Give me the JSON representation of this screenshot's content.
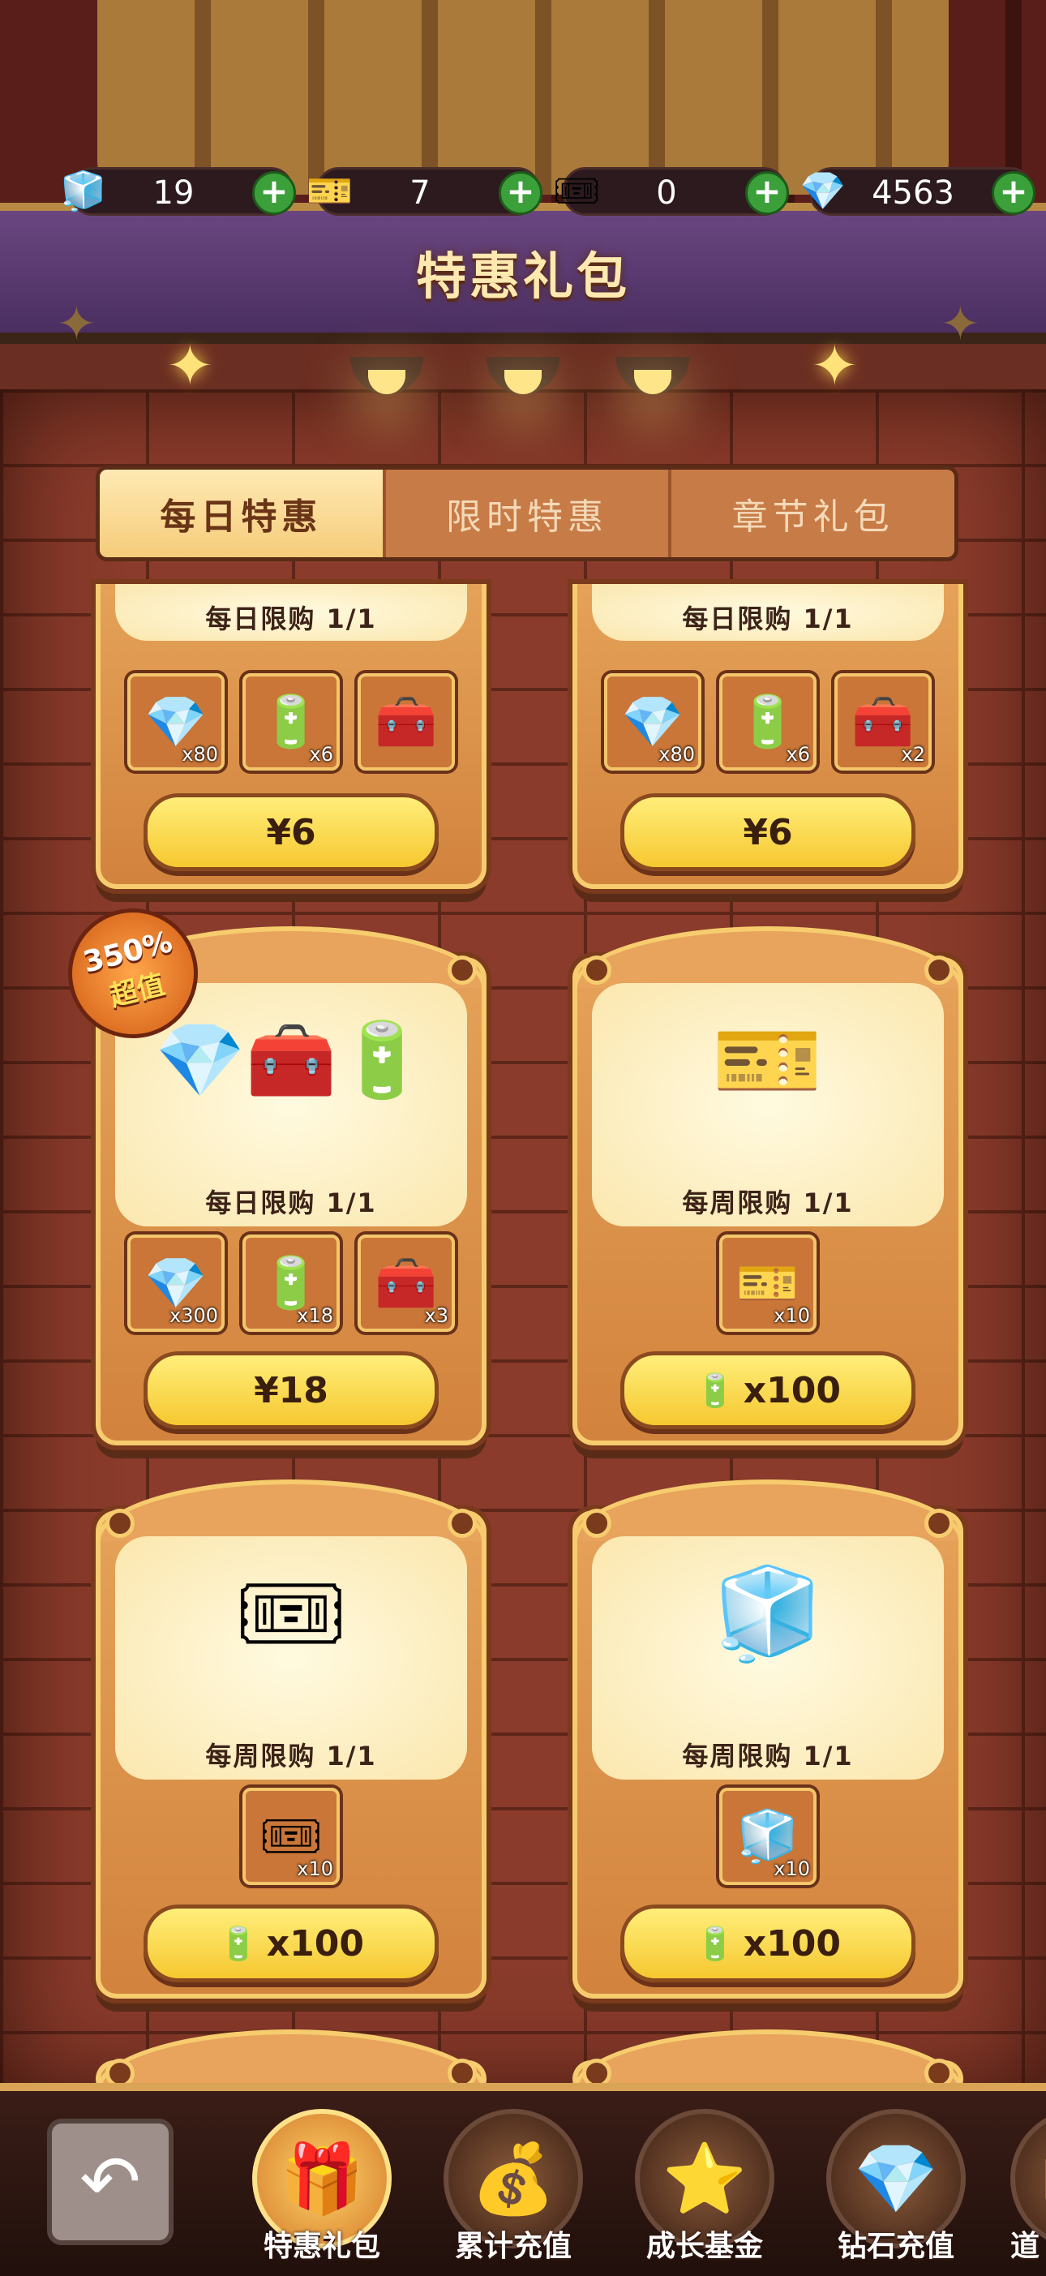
{
  "currencies": [
    {
      "icon": "cube-icon",
      "symbol": "🧊",
      "value": "19"
    },
    {
      "icon": "gold-ticket-icon",
      "symbol": "🎫",
      "value": "7"
    },
    {
      "icon": "blue-ticket-icon",
      "symbol": "🎟",
      "value": "0"
    },
    {
      "icon": "diamond-icon",
      "symbol": "💎",
      "value": "4563"
    }
  ],
  "title": "特惠礼包",
  "tabs": [
    "每日特惠",
    "限时特惠",
    "章节礼包"
  ],
  "cards": [
    {
      "limit": "每日限购  1/1",
      "items": [
        {
          "icon": "diamond-icon",
          "symbol": "💎",
          "qty": "x80"
        },
        {
          "icon": "battery-icon",
          "symbol": "🔋",
          "qty": "x6"
        },
        {
          "icon": "chest-icon",
          "symbol": "🧰",
          "qty": ""
        }
      ],
      "price": "¥6"
    },
    {
      "limit": "每日限购  1/1",
      "items": [
        {
          "icon": "diamond-icon",
          "symbol": "💎",
          "qty": "x80"
        },
        {
          "icon": "battery-icon",
          "symbol": "🔋",
          "qty": "x6"
        },
        {
          "icon": "chest-icon",
          "symbol": "🧰",
          "qty": "x2"
        }
      ],
      "price": "¥6"
    },
    {
      "limit": "每日限购  1/1",
      "art": "💎🧰🔋",
      "items": [
        {
          "icon": "diamond-icon",
          "symbol": "💎",
          "qty": "x300"
        },
        {
          "icon": "battery-icon",
          "symbol": "🔋",
          "qty": "x18"
        },
        {
          "icon": "chest-icon",
          "symbol": "🧰",
          "qty": "x3"
        }
      ],
      "price": "¥18"
    },
    {
      "limit": "每周限购  1/1",
      "art": "🎫",
      "items": [
        {
          "icon": "gold-ticket-icon",
          "symbol": "🎫",
          "qty": "x10"
        }
      ],
      "price": "x100"
    },
    {
      "limit": "每周限购  1/1",
      "art": "🎟",
      "items": [
        {
          "icon": "blue-ticket-icon",
          "symbol": "🎟",
          "qty": "x10"
        }
      ],
      "price": "x100"
    },
    {
      "limit": "每周限购  1/1",
      "art": "🧊",
      "items": [
        {
          "icon": "cube-icon",
          "symbol": "🧊",
          "qty": "x10"
        }
      ],
      "price": "x100"
    }
  ],
  "badge": {
    "percent": "350%",
    "label": "超值"
  },
  "price_icon": "🔋",
  "nav": [
    {
      "label": "特惠礼包",
      "symbol": "🎁"
    },
    {
      "label": "累计充值",
      "symbol": "💰"
    },
    {
      "label": "成长基金",
      "symbol": "⭐"
    },
    {
      "label": "钻石充值",
      "symbol": "💎"
    },
    {
      "label": "道",
      "symbol": "📦"
    }
  ],
  "back_symbol": "↶"
}
